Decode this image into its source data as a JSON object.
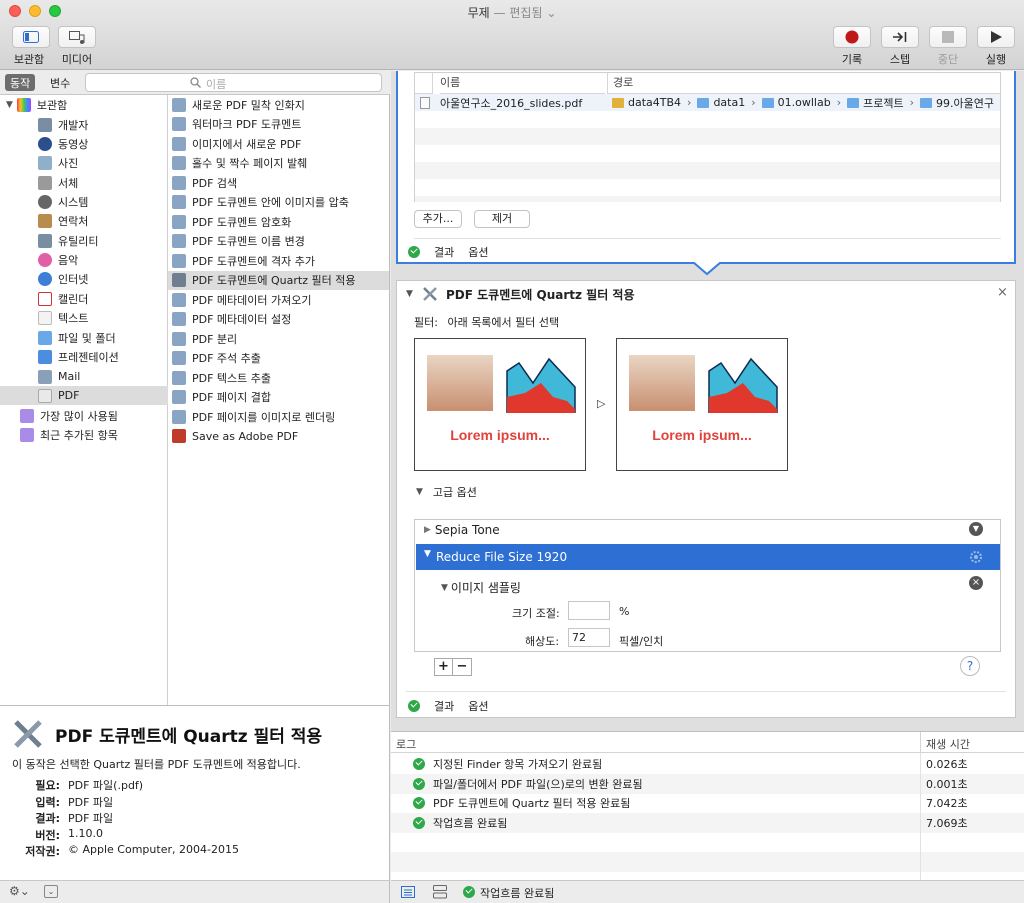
{
  "window": {
    "title": "무제",
    "subtitle": "— 편집됨"
  },
  "toolbar": {
    "library": "보관함",
    "media": "미디어",
    "record": "기록",
    "step": "스텝",
    "stop": "중단",
    "run": "실행"
  },
  "left_tabs": {
    "actions": "동작",
    "variables": "변수"
  },
  "search": {
    "placeholder": "이름"
  },
  "library": {
    "root": "보관함",
    "items": [
      "개발자",
      "동영상",
      "사진",
      "서체",
      "시스템",
      "연락처",
      "유틸리티",
      "음악",
      "인터넷",
      "캘린더",
      "텍스트",
      "파일 및 폴더",
      "프레젠테이션",
      "Mail",
      "PDF"
    ],
    "selected": "PDF",
    "most_used": "가장 많이 사용됨",
    "recent": "최근 추가된 항목"
  },
  "actions": {
    "items": [
      "새로운 PDF 밀착 인화지",
      "워터마크 PDF 도큐멘트",
      "이미지에서 새로운 PDF",
      "홀수 및 짝수 페이지 발췌",
      "PDF 검색",
      "PDF 도큐멘트 안에 이미지를 압축",
      "PDF 도큐멘트 암호화",
      "PDF 도큐멘트 이름 변경",
      "PDF 도큐멘트에 격자 추가",
      "PDF 도큐멘트에 Quartz 필터 적용",
      "PDF 메타데이터 가져오기",
      "PDF 메타데이터 설정",
      "PDF 분리",
      "PDF 주석 추출",
      "PDF 텍스트 추출",
      "PDF 페이지 결합",
      "PDF 페이지를 이미지로 렌더링",
      "Save as Adobe PDF"
    ],
    "selected_index": 9
  },
  "description": {
    "title": "PDF 도큐멘트에 Quartz 필터 적용",
    "text": "이 동작은 선택한 Quartz 필터를 PDF 도큐멘트에 적용합니다.",
    "fields": [
      {
        "k": "필요:",
        "v": "PDF 파일(.pdf)"
      },
      {
        "k": "입력:",
        "v": "PDF 파일"
      },
      {
        "k": "결과:",
        "v": "PDF 파일"
      },
      {
        "k": "버전:",
        "v": "1.10.0"
      },
      {
        "k": "저작권:",
        "v": "© Apple Computer, 2004-2015"
      }
    ]
  },
  "file_table": {
    "col_name": "이름",
    "col_path": "경로",
    "file": "아울연구소_2016_slides.pdf",
    "path": [
      "data4TB4",
      "data1",
      "01.owllab",
      "프로젝트",
      "99.아울연구"
    ],
    "add_btn": "추가...",
    "remove_btn": "제거",
    "results": "결과",
    "options": "옵션"
  },
  "filter_action": {
    "title": "PDF 도큐멘트에 Quartz 필터 적용",
    "filter_label": "필터:",
    "filter_value": "아래 목록에서 필터 선택",
    "preview_text": "Lorem ipsum...",
    "advanced": "고급 옵션",
    "options": [
      "Sepia Tone",
      "Reduce File Size 1920"
    ],
    "sub_option": "이미지 샘플링",
    "scale_label": "크기 조절:",
    "scale_value": "",
    "scale_unit": "%",
    "res_label": "해상도:",
    "res_value": "72",
    "res_unit": "픽셀/인치",
    "results": "결과",
    "options_label": "옵션",
    "help": "?"
  },
  "log": {
    "col_log": "로그",
    "col_time": "재생 시간",
    "rows": [
      {
        "text": "지정된 Finder 항목 가져오기 완료됨",
        "time": "0.026초"
      },
      {
        "text": "파일/폴더에서 PDF 파일(으)로의 변환 완료됨",
        "time": "0.001초"
      },
      {
        "text": "PDF 도큐멘트에 Quartz 필터 적용 완료됨",
        "time": "7.042초"
      },
      {
        "text": "작업흐름 완료됨",
        "time": "7.069초"
      }
    ]
  },
  "status": {
    "text": "작업흐름 완료됨"
  },
  "colors": {
    "accent": "#2d6fd2",
    "ok": "#2fa84a",
    "record": "#c01818"
  }
}
